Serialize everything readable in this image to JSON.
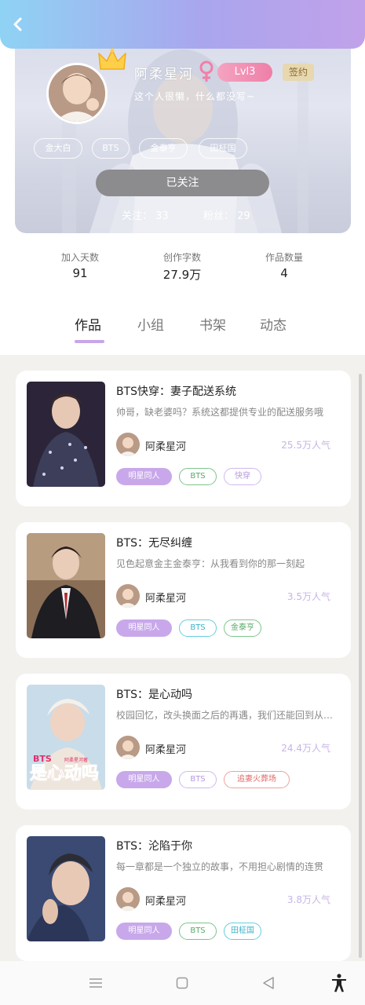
{
  "header": {
    "back_icon": "chevron-left-icon"
  },
  "profile": {
    "name": "阿柔星河",
    "gender": "female",
    "level": "Lvl3",
    "signed_badge": "签约",
    "bio": "这个人很懒，什么都没写~",
    "tags": [
      "金大白",
      "BTS",
      "金泰亨",
      "田柾国"
    ],
    "follow_button": "已关注",
    "following_label": "关注： 33",
    "fans_label": "粉丝： 29"
  },
  "stats": {
    "days_label": "加入天数",
    "days_value": "91",
    "words_label": "创作字数",
    "words_value": "27.9万",
    "works_label": "作品数量",
    "works_value": "4"
  },
  "tabs": [
    "作品",
    "小组",
    "书架",
    "动态"
  ],
  "works": [
    {
      "title": "BTS快穿：妻子配送系统",
      "desc": "帅哥，缺老婆吗？系统这都提供专业的配送服务哦",
      "author": "阿柔星河",
      "popularity": "25.5万人气",
      "tags": [
        {
          "text": "明星同人",
          "style": "fill"
        },
        {
          "text": "BTS",
          "style": "green"
        },
        {
          "text": "快穿",
          "style": "purple"
        }
      ]
    },
    {
      "title": "BTS：无尽纠缠",
      "desc": "见色起意金主金泰亨：从我看到你的那一刻起",
      "author": "阿柔星河",
      "popularity": "3.5万人气",
      "tags": [
        {
          "text": "明星同人",
          "style": "fill"
        },
        {
          "text": "BTS",
          "style": "teal"
        },
        {
          "text": "金泰亨",
          "style": "green"
        }
      ]
    },
    {
      "title": "BTS：是心动吗",
      "desc": "校园回忆，改头换面之后的再遇，我们还能回到从前吗",
      "author": "阿柔星河",
      "popularity": "24.4万人气",
      "tags": [
        {
          "text": "明星同人",
          "style": "fill"
        },
        {
          "text": "BTS",
          "style": "purple"
        },
        {
          "text": "追妻火葬场",
          "style": "red"
        }
      ]
    },
    {
      "title": "BTS：沦陷于你",
      "desc": "每一章都是一个独立的故事，不用担心剧情的连贯",
      "author": "阿柔星河",
      "popularity": "3.8万人气",
      "tags": [
        {
          "text": "明星同人",
          "style": "fill"
        },
        {
          "text": "BTS",
          "style": "green"
        },
        {
          "text": "田柾国",
          "style": "teal"
        }
      ]
    }
  ],
  "cover_texts": {
    "cover3_big": "是心动吗",
    "cover3_prefix": "BTS",
    "cover3_small": "阿柔星河著"
  },
  "navbar": [
    "menu-icon",
    "home-icon",
    "back-triangle-icon",
    "accessibility-icon"
  ]
}
